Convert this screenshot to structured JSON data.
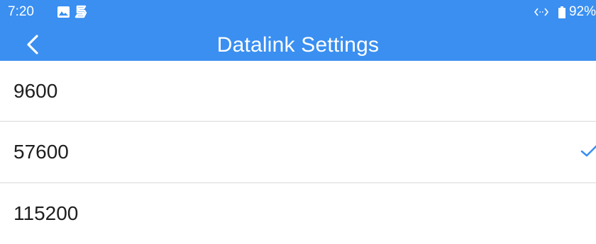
{
  "status_bar": {
    "time": "7:20",
    "battery": "92%",
    "icons": [
      "image-icon",
      "s-app-icon",
      "link-arrows-icon",
      "battery-icon"
    ]
  },
  "nav": {
    "title": "Datalink Settings",
    "back_icon": "back-chevron-icon"
  },
  "options": [
    {
      "label": "9600",
      "selected": false
    },
    {
      "label": "57600",
      "selected": true
    },
    {
      "label": "115200",
      "selected": false
    }
  ],
  "colors": {
    "header": "#3a8ff1",
    "check": "#3a8ff1",
    "divider": "#d9d9d9"
  }
}
